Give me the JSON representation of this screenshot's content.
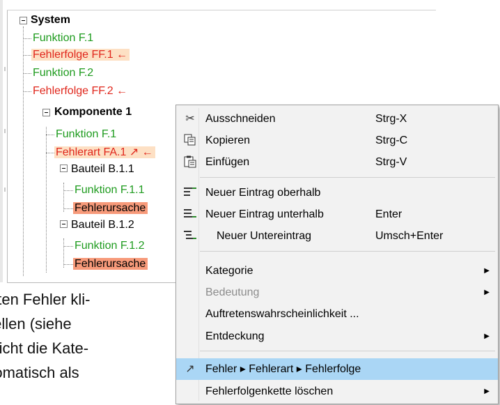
{
  "tree": {
    "system_label": "System",
    "items": [
      {
        "label": "Funktion F.1"
      },
      {
        "label": "Fehlerfolge FF.1 ←"
      },
      {
        "label": "Funktion F.2"
      },
      {
        "label": "Fehlerfolge FF.2 ←"
      },
      {
        "label": "Komponente 1"
      },
      {
        "label": "Funktion F.1"
      },
      {
        "label": "Fehlerart FA.1 ↗ ←"
      },
      {
        "label": "Bauteil B.1.1"
      },
      {
        "label": "Funktion F.1.1"
      },
      {
        "label": "Fehlerursache"
      },
      {
        "label": "Bauteil B.1.2"
      },
      {
        "label": "Funktion F.1.2"
      },
      {
        "label": "Fehlerursache"
      }
    ]
  },
  "body_text": {
    "lines": [
      "nsten Fehler kli-",
      "stellen (siehe",
      "r nicht die Kate-",
      "utomatisch als"
    ]
  },
  "context_menu": {
    "items": [
      {
        "label": "Ausschneiden",
        "shortcut": "Strg-X",
        "icon": "scissors-icon"
      },
      {
        "label": "Kopieren",
        "shortcut": "Strg-C",
        "icon": "copy-icon"
      },
      {
        "label": "Einfügen",
        "shortcut": "Strg-V",
        "icon": "paste-icon"
      },
      {
        "label": "Neuer Eintrag oberhalb",
        "shortcut": "",
        "icon": "insert-above-icon"
      },
      {
        "label": "Neuer Eintrag unterhalb",
        "shortcut": "Enter",
        "icon": "insert-below-icon"
      },
      {
        "label": "Neuer Untereintrag",
        "shortcut": "Umsch+Enter",
        "icon": "insert-child-icon"
      },
      {
        "label": "Kategorie"
      },
      {
        "label": "Bedeutung"
      },
      {
        "label": "Auftretenswahrscheinlichkeit ..."
      },
      {
        "label": "Entdeckung"
      },
      {
        "label": "Fehler ▸ Fehlerart ▸ Fehlerfolge",
        "icon": "link-arrow-icon"
      },
      {
        "label": "Fehlerfolgenkette löschen"
      }
    ],
    "selection_color": "#aad6f5"
  },
  "colors": {
    "function": "#1e9b1e",
    "failure": "#e0261b",
    "highlight_light": "#fde0c4",
    "highlight_strong": "#f79a7a"
  }
}
